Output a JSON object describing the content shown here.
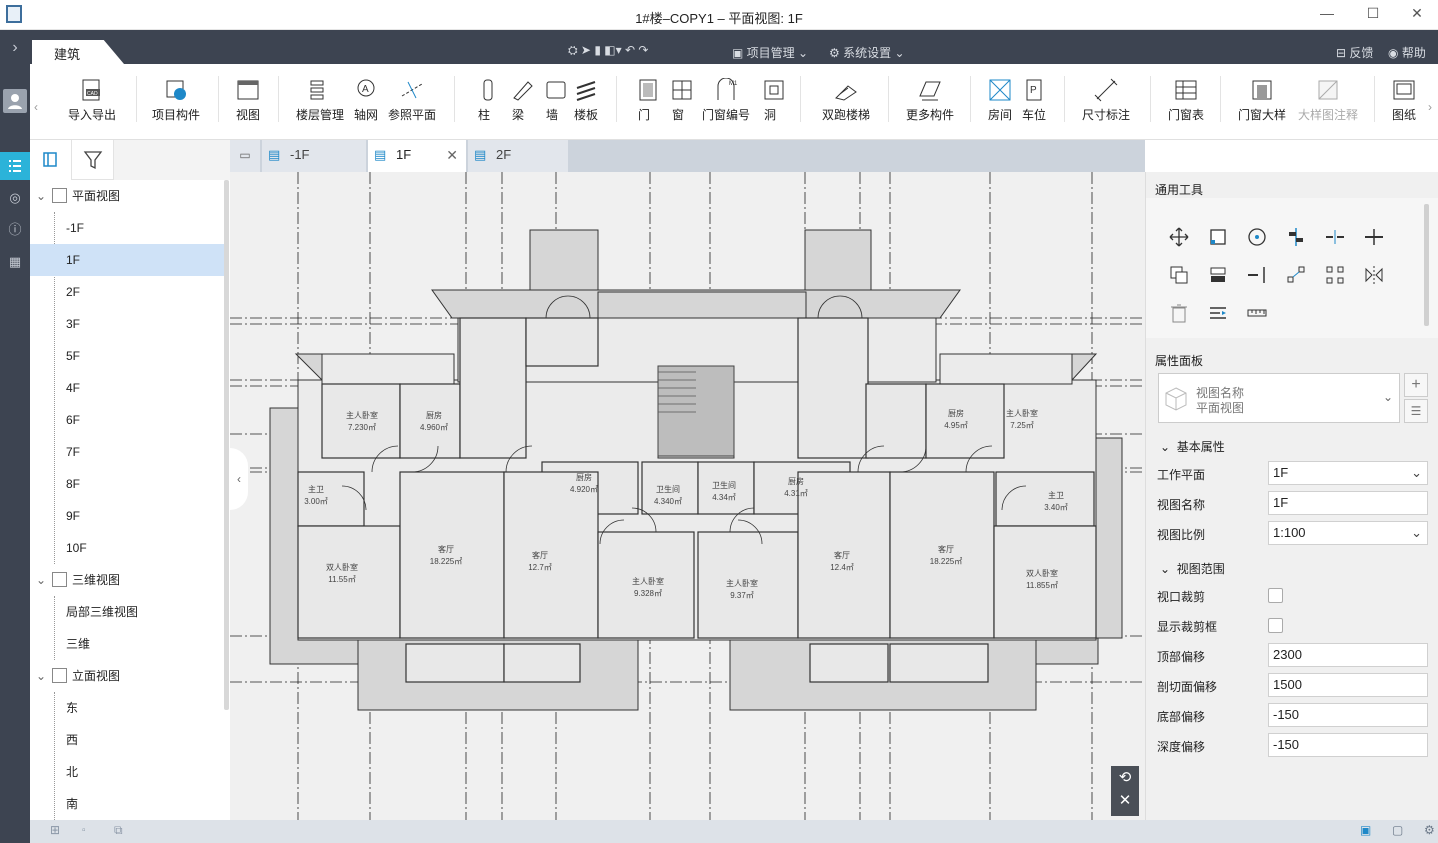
{
  "window": {
    "title": "1#楼–COPY1 – 平面视图: 1F",
    "minimize_glyph": "—",
    "maximize_glyph": "☐",
    "close_glyph": "✕"
  },
  "ribbon": {
    "tab": "建筑",
    "project_menu": "项目管理",
    "system_menu": "系统设置",
    "feedback": "反馈",
    "help": "帮助"
  },
  "toolbar": {
    "import_export": "导入导出",
    "project_parts": "项目构件",
    "view": "视图",
    "floor_mgmt": "楼层管理",
    "axis_net": "轴网",
    "ref_plane": "参照平面",
    "column": "柱",
    "beam": "梁",
    "wall": "墙",
    "slab": "楼板",
    "door": "门",
    "window": "窗",
    "door_window_no": "门窗编号",
    "opening": "洞",
    "double_stair": "双跑楼梯",
    "more_parts": "更多构件",
    "room": "房间",
    "parking": "车位",
    "dimension": "尺寸标注",
    "door_window_table": "门窗表",
    "door_window_detail": "门窗大样",
    "detail_annot": "大样图注释",
    "drawing": "图纸"
  },
  "tree": {
    "plan_views": "平面视图",
    "plan_items": [
      "-1F",
      "1F",
      "2F",
      "3F",
      "5F",
      "4F",
      "6F",
      "7F",
      "8F",
      "9F",
      "10F"
    ],
    "view_3d": "三维视图",
    "items_3d": [
      "局部三维视图",
      "三维"
    ],
    "elev_views": "立面视图",
    "elev_items": [
      "东",
      "西",
      "北",
      "南"
    ]
  },
  "doc_tabs": [
    "-1F",
    "1F",
    "2F"
  ],
  "rooms": {
    "r1": "主人卧室",
    "r1a": "7.230㎡",
    "r2": "厨房",
    "r2a": "4.960㎡",
    "r3": "厨房",
    "r3a": "4.920㎡",
    "r4": "卫生间",
    "r4a": "4.340㎡",
    "r5": "卫生间",
    "r5a": "4.34㎡",
    "r6": "厨房",
    "r6a": "4.31㎡",
    "r7": "厨房",
    "r7a": "4.95㎡",
    "r8": "主人卧室",
    "r8a": "7.25㎡",
    "r9": "主卫",
    "r9a": "3.00㎡",
    "r10": "主卫",
    "r10a": "3.40㎡",
    "r11": "双人卧室",
    "r11a": "11.55㎡",
    "r12": "客厅",
    "r12a": "18.225㎡",
    "r13": "客厅",
    "r13a": "12.7㎡",
    "r14": "主人卧室",
    "r14a": "9.328㎡",
    "r15": "主人卧室",
    "r15a": "9.37㎡",
    "r16": "客厅",
    "r16a": "12.4㎡",
    "r17": "客厅",
    "r17a": "18.225㎡",
    "r18": "双人卧室",
    "r18a": "11.855㎡"
  },
  "tools_panel": {
    "title": "通用工具"
  },
  "properties": {
    "title": "属性面板",
    "type_name": "视图名称",
    "type_value": "平面视图",
    "basic_section": "基本属性",
    "work_plane_label": "工作平面",
    "work_plane_value": "1F",
    "view_name_label": "视图名称",
    "view_name_value": "1F",
    "scale_label": "视图比例",
    "scale_value": "1:100",
    "range_section": "视图范围",
    "crop_label": "视口裁剪",
    "crop_frame_label": "显示裁剪框",
    "top_offset_label": "顶部偏移",
    "top_offset_value": "2300",
    "cut_offset_label": "剖切面偏移",
    "cut_offset_value": "1500",
    "bottom_offset_label": "底部偏移",
    "bottom_offset_value": "-150",
    "depth_offset_label": "深度偏移",
    "depth_offset_value": "-150"
  },
  "colors": {
    "dark_ribbon": "#3d4451",
    "accent": "#1e88c8",
    "selection": "#cfe2f7",
    "accent_active": "#2bb3d9"
  }
}
